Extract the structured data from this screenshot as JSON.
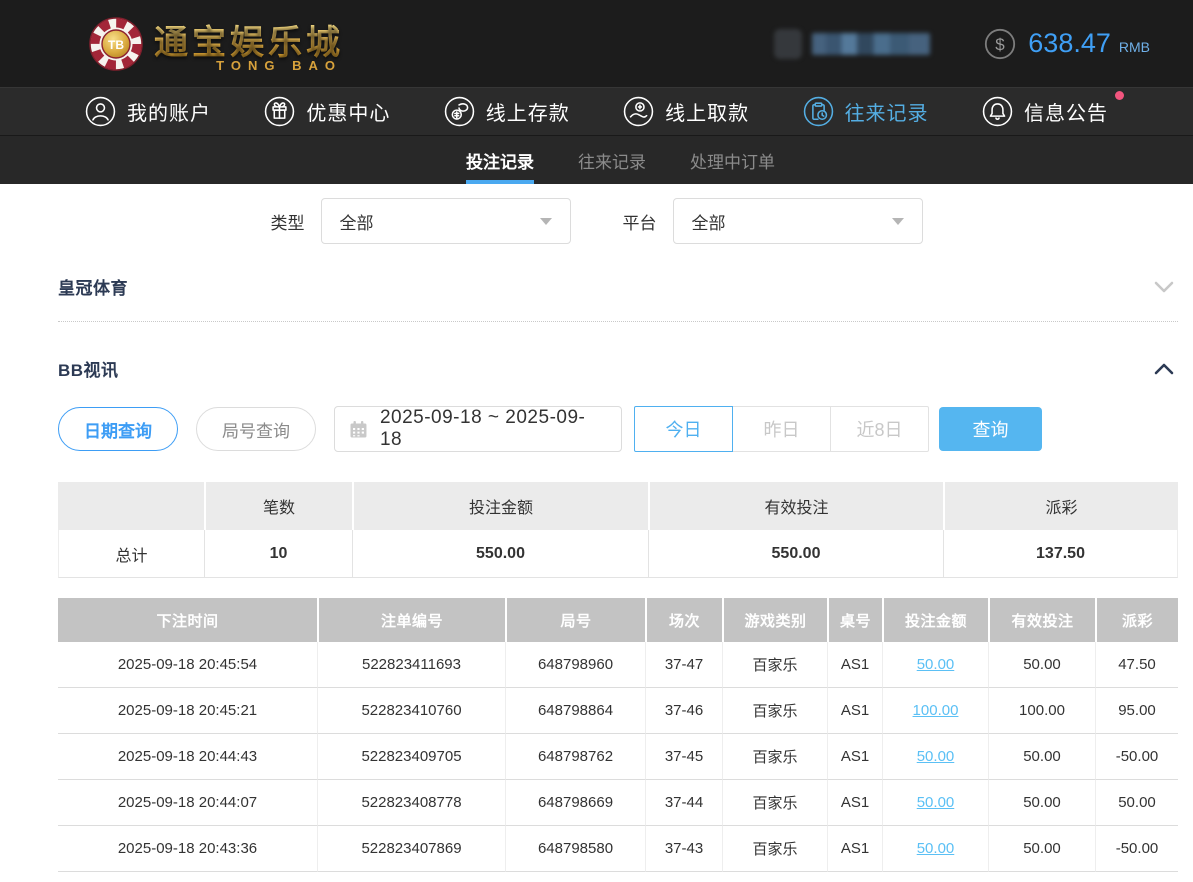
{
  "header": {
    "logo": {
      "chip_label": "TB",
      "title": "通宝娱乐城",
      "subtitle": "TONG BAO"
    },
    "balance": {
      "amount": "638.47",
      "currency": "RMB"
    }
  },
  "nav": {
    "items": [
      {
        "label": "我的账户",
        "icon": "user-icon",
        "active": false
      },
      {
        "label": "优惠中心",
        "icon": "gift-icon",
        "active": false
      },
      {
        "label": "线上存款",
        "icon": "deposit-icon",
        "active": false
      },
      {
        "label": "线上取款",
        "icon": "withdraw-icon",
        "active": false
      },
      {
        "label": "往来记录",
        "icon": "records-icon",
        "active": true
      },
      {
        "label": "信息公告",
        "icon": "bell-icon",
        "active": false,
        "badge": true
      }
    ]
  },
  "tabs": [
    {
      "label": "投注记录",
      "active": true
    },
    {
      "label": "往来记录",
      "active": false
    },
    {
      "label": "处理中订单",
      "active": false
    }
  ],
  "filters": {
    "type_label": "类型",
    "type_value": "全部",
    "platform_label": "平台",
    "platform_value": "全部"
  },
  "sections": [
    {
      "title": "皇冠体育",
      "collapsed": true
    },
    {
      "title": "BB视讯",
      "collapsed": false
    }
  ],
  "query_bar": {
    "date_query": "日期查询",
    "round_query": "局号查询",
    "date_range": "2025-09-18 ~ 2025-09-18",
    "quick_buttons": [
      "今日",
      "昨日",
      "近8日"
    ],
    "quick_active": "今日",
    "search_label": "查询"
  },
  "summary_table": {
    "headers": [
      "",
      "笔数",
      "投注金额",
      "有效投注",
      "派彩"
    ],
    "row_label": "总计",
    "values": [
      "10",
      "550.00",
      "550.00",
      "137.50"
    ]
  },
  "bet_table": {
    "headers": [
      "下注时间",
      "注单编号",
      "局号",
      "场次",
      "游戏类别",
      "桌号",
      "投注金额",
      "有效投注",
      "派彩"
    ],
    "rows": [
      [
        "2025-09-18 20:45:54",
        "522823411693",
        "648798960",
        "37-47",
        "百家乐",
        "AS1",
        "50.00",
        "50.00",
        "47.50"
      ],
      [
        "2025-09-18 20:45:21",
        "522823410760",
        "648798864",
        "37-46",
        "百家乐",
        "AS1",
        "100.00",
        "100.00",
        "95.00"
      ],
      [
        "2025-09-18 20:44:43",
        "522823409705",
        "648798762",
        "37-45",
        "百家乐",
        "AS1",
        "50.00",
        "50.00",
        "-50.00"
      ],
      [
        "2025-09-18 20:44:07",
        "522823408778",
        "648798669",
        "37-44",
        "百家乐",
        "AS1",
        "50.00",
        "50.00",
        "50.00"
      ],
      [
        "2025-09-18 20:43:36",
        "522823407869",
        "648798580",
        "37-43",
        "百家乐",
        "AS1",
        "50.00",
        "50.00",
        "-50.00"
      ]
    ]
  },
  "colors": {
    "accent_blue": "#4fb0f0",
    "balance_blue": "#3f9ff5",
    "link_blue": "#5bc0f5",
    "negative_red": "#f0506a",
    "section_navy": "#2c3a54",
    "badge_pink": "#f2557e",
    "header_bg": "#1c1c1c",
    "nav_bg": "#2b2b2b",
    "table_header_gray": "#c3c3c3"
  }
}
